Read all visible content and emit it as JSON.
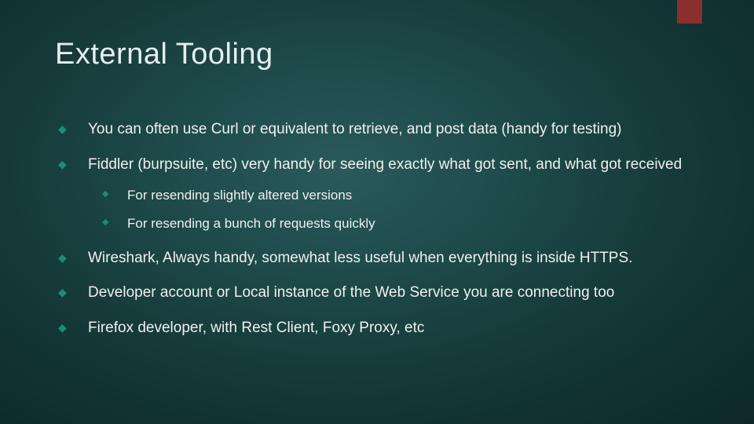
{
  "title": "External Tooling",
  "bullets": [
    {
      "text": "You can often use Curl or equivalent to retrieve, and post data (handy for testing)"
    },
    {
      "text": "Fiddler (burpsuite, etc) very handy for seeing exactly what got sent, and what got received",
      "sub": [
        "For resending slightly altered versions",
        "For resending a bunch of requests quickly"
      ]
    },
    {
      "text": "Wireshark, Always handy, somewhat less useful when everything is inside HTTPS."
    },
    {
      "text": "Developer account or Local instance of the Web Service you are connecting too"
    },
    {
      "text": "Firefox developer, with Rest Client, Foxy Proxy, etc"
    }
  ],
  "colors": {
    "accent_bar": "#8b2e2e",
    "bullet_diamond": "#1a8c7a"
  }
}
